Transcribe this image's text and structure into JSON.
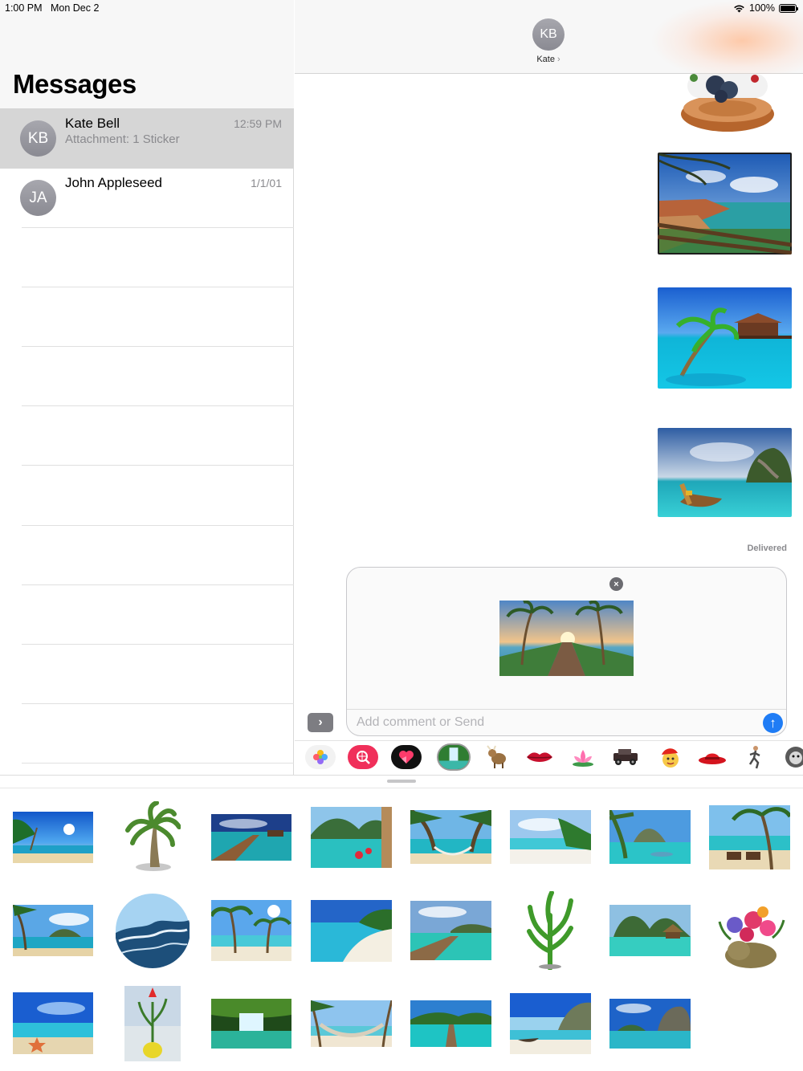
{
  "status_bar": {
    "time": "1:00 PM",
    "date": "Mon Dec 2",
    "battery": "100%",
    "wifi_icon": "wifi-icon",
    "battery_icon": "battery-icon"
  },
  "sidebar": {
    "title": "Messages",
    "conversations": [
      {
        "initials": "KB",
        "name": "Kate Bell",
        "preview": "Attachment: 1 Sticker",
        "time": "12:59 PM",
        "selected": true
      },
      {
        "initials": "JA",
        "name": "John Appleseed",
        "preview": "",
        "time": "1/1/01",
        "selected": false
      }
    ]
  },
  "chat": {
    "contact_initials": "KB",
    "contact_name": "Kate",
    "chevron": "›",
    "delivered": "Delivered",
    "messages": [
      "flower-pot-sticker",
      "beach-cliff-photo",
      "overwater-bungalow-photo",
      "longtail-boat-photo"
    ]
  },
  "compose": {
    "placeholder": "Add comment or Send",
    "attachment": "pier-sunset-photo",
    "close_glyph": "×",
    "send_glyph": "↑",
    "expand_glyph": "›"
  },
  "app_drawer": [
    "photos-icon",
    "web-search-icon",
    "heart-sticker-icon",
    "waterfall-sticker-app-icon",
    "goat-sticker-icon",
    "lips-sticker-icon",
    "lotus-sticker-icon",
    "car-sticker-icon",
    "santa-emoji-icon",
    "hat-sticker-icon",
    "runner-sticker-icon",
    "animal-sticker-icon"
  ],
  "sticker_tray": [
    "beach-palm-sun",
    "palm-tree",
    "wooden-pier-sea",
    "tropical-bay-flowers",
    "hammock-palms",
    "white-sand-beach",
    "turquoise-cove",
    "beach-chairs-palm",
    "palm-island-view",
    "ocean-wave-circle",
    "palm-beach-sun",
    "shore-shallow-water",
    "jetty-bay",
    "green-plant",
    "island-hut",
    "flower-pot",
    "sea-starfish",
    "flower-vase",
    "waterfall-forest",
    "beach-hammock",
    "pier-island",
    "cliff-beach-boat",
    "rock-island-bay"
  ],
  "colors": {
    "accent_blue": "#1f7cf5",
    "avatar_gray": "#8e8e93",
    "selected_row": "#d6d6d6",
    "secondary_text": "#8a8a8e"
  }
}
